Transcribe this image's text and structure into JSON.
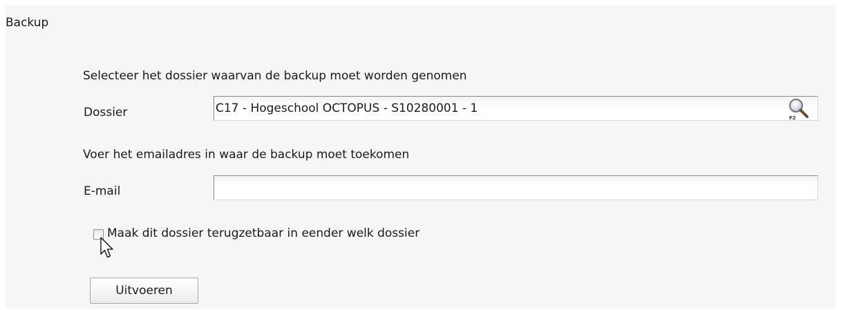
{
  "panel": {
    "title": "Backup"
  },
  "dossier_section": {
    "instruction": "Selecteer het dossier waarvan de backup moet worden genomen",
    "field_label": "Dossier",
    "field_value": "C17 - Hogeschool OCTOPUS - S10280001 - 1",
    "lookup_icon": "search-f2-icon",
    "lookup_key": "F2"
  },
  "email_section": {
    "instruction": "Voer het emailadres in waar de backup moet toekomen",
    "field_label": "E-mail",
    "field_value": ""
  },
  "restore_option": {
    "label": "Maak dit dossier terugzetbaar in eender welk dossier",
    "checked": false
  },
  "actions": {
    "run_label": "Uitvoeren"
  },
  "colors": {
    "panel_background": "#f6f6f6",
    "page_background": "#ffffff",
    "text": "#1a1a1a",
    "input_border": "#8a8a8a"
  }
}
